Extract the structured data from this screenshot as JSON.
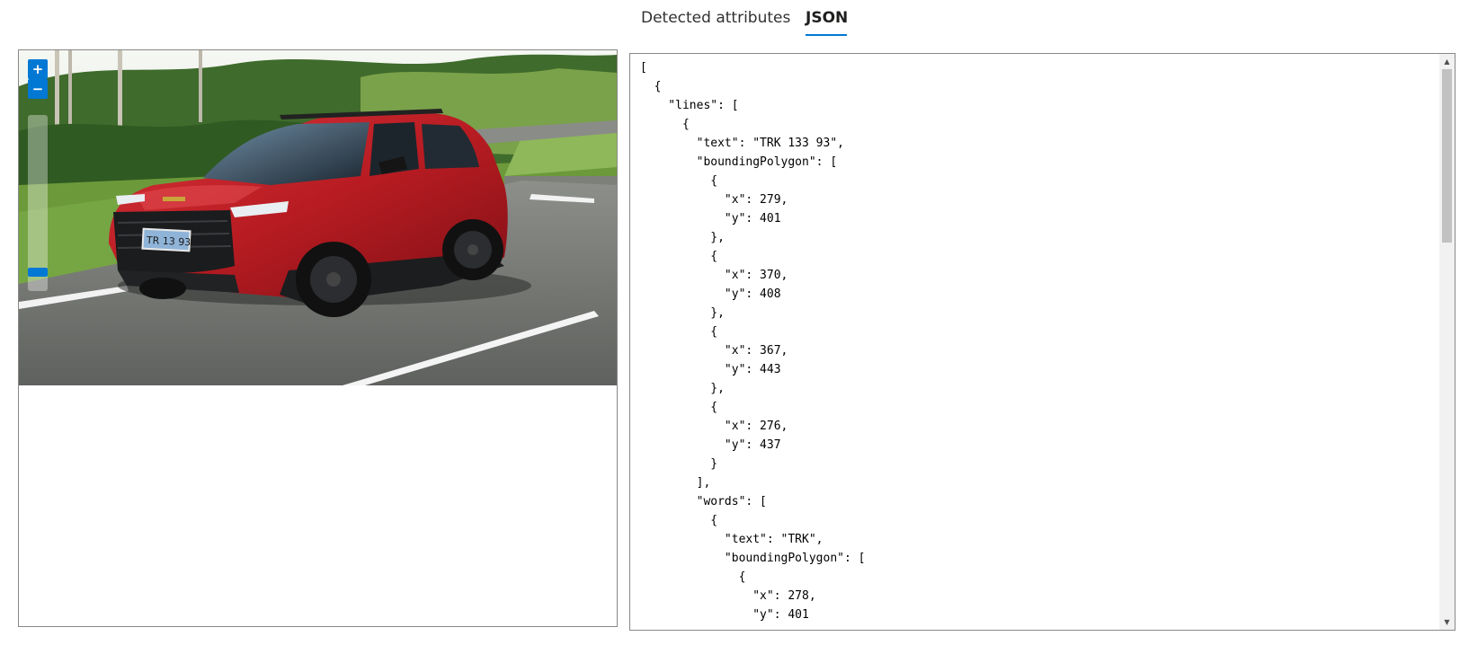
{
  "tabs": {
    "detected_attributes": "Detected attributes",
    "json": "JSON",
    "active": "JSON"
  },
  "viewer": {
    "zoom_in_label": "+",
    "zoom_out_label": "−",
    "plate_text": "TRK 133 93"
  },
  "json_output": {
    "lines": [
      "[",
      "  {",
      "    \"lines\": [",
      "      {",
      "        \"text\": \"TRK 133 93\",",
      "        \"boundingPolygon\": [",
      "          {",
      "            \"x\": 279,",
      "            \"y\": 401",
      "          },",
      "          {",
      "            \"x\": 370,",
      "            \"y\": 408",
      "          },",
      "          {",
      "            \"x\": 367,",
      "            \"y\": 443",
      "          },",
      "          {",
      "            \"x\": 276,",
      "            \"y\": 437",
      "          }",
      "        ],",
      "        \"words\": [",
      "          {",
      "            \"text\": \"TRK\",",
      "            \"boundingPolygon\": [",
      "              {",
      "                \"x\": 278,",
      "                \"y\": 401"
    ]
  },
  "colors": {
    "accent": "#0078d4",
    "car_body": "#b81c22",
    "border": "#8a8886"
  },
  "icons": {
    "zoom_in": "plus-icon",
    "zoom_out": "minus-icon",
    "scroll_up": "triangle-up-icon",
    "scroll_down": "triangle-down-icon"
  }
}
